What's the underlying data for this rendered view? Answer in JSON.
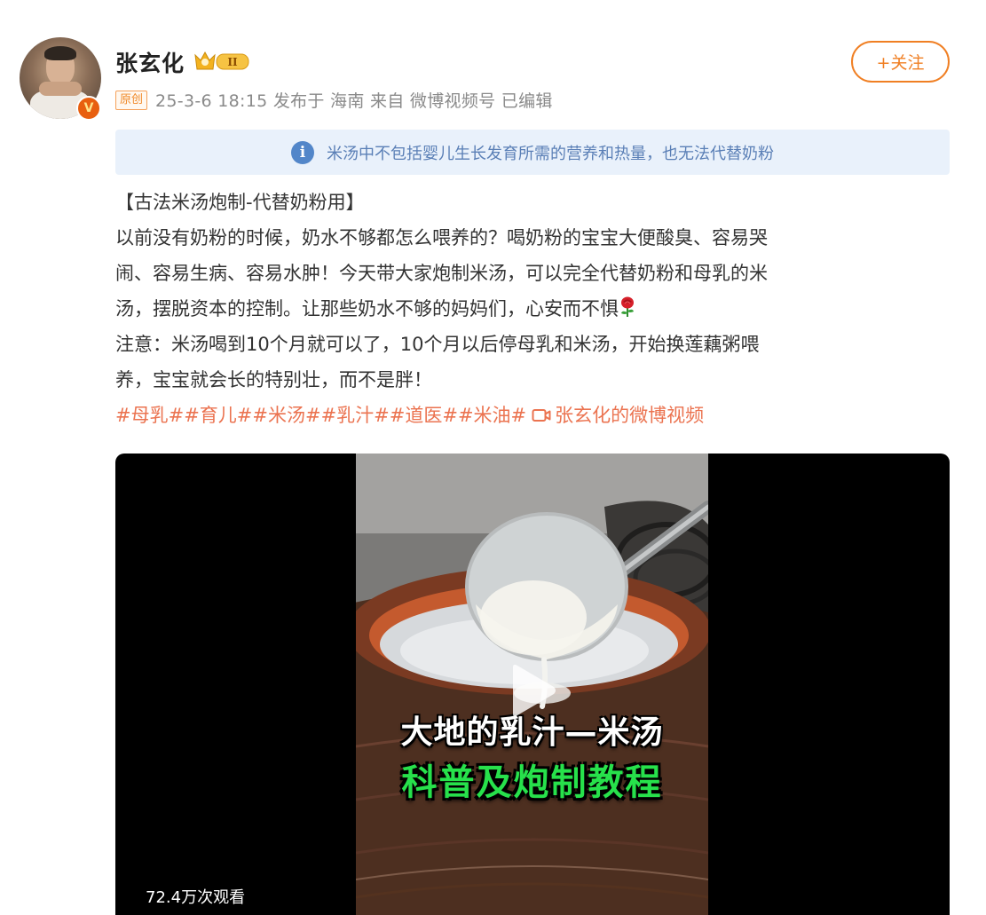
{
  "user": {
    "name": "张玄化",
    "verified_badge_letter": "V",
    "level_badge_text": "II"
  },
  "meta": {
    "original_tag": "原创",
    "info": "25-3-6 18:15 发布于 海南 来自 微博视频号 已编辑"
  },
  "follow_button": "+关注",
  "notice": {
    "icon": "info-icon",
    "icon_glyph": "i",
    "text": "米汤中不包括婴儿生长发育所需的营养和热量，也无法代替奶粉"
  },
  "post": {
    "lines": [
      "【古法米汤炮制-代替奶粉用】",
      "以前没有奶粉的时候，奶水不够都怎么喂养的？喝奶粉的宝宝大便酸臭、容易哭",
      "闹、容易生病、容易水肿！今天带大家炮制米汤，可以完全代替奶粉和母乳的米",
      "汤，摆脱资本的控制。让那些奶水不够的妈妈们，心安而不惧",
      "注意：米汤喝到10个月就可以了，10个月以后停母乳和米汤，开始换莲藕粥喂",
      "养，宝宝就会长的特别壮，而不是胖！"
    ],
    "emoji": "rose-icon",
    "hashtags": "#母乳##育儿##米汤##乳汁##道医##米油#",
    "video_link": "张玄化的微博视频"
  },
  "video": {
    "caption_line1": "大地的乳汁—米汤",
    "caption_line2": "科普及炮制教程",
    "views": "72.4万次观看"
  },
  "colors": {
    "accent": "#f07f23",
    "hashtag": "#eb7350",
    "notice_bg": "#e9f1fb",
    "notice_text": "#5a7fb6",
    "caption_green": "#27e14b"
  }
}
